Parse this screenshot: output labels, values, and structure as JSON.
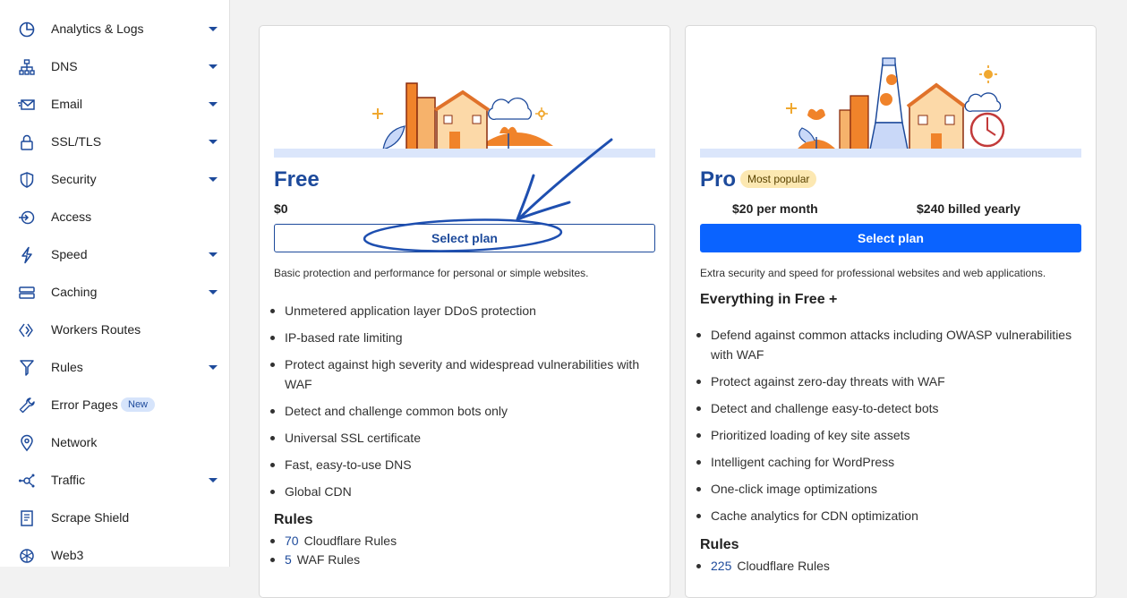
{
  "sidebar": {
    "items": [
      {
        "label": "Analytics & Logs",
        "icon": "analytics-icon",
        "caret": true
      },
      {
        "label": "DNS",
        "icon": "dns-icon",
        "caret": true
      },
      {
        "label": "Email",
        "icon": "email-icon",
        "caret": true
      },
      {
        "label": "SSL/TLS",
        "icon": "lock-icon",
        "caret": true
      },
      {
        "label": "Security",
        "icon": "shield-icon",
        "caret": true
      },
      {
        "label": "Access",
        "icon": "access-icon",
        "caret": false
      },
      {
        "label": "Speed",
        "icon": "lightning-icon",
        "caret": true
      },
      {
        "label": "Caching",
        "icon": "caching-icon",
        "caret": true
      },
      {
        "label": "Workers Routes",
        "icon": "workers-icon",
        "caret": false
      },
      {
        "label": "Rules",
        "icon": "rules-icon",
        "caret": true
      },
      {
        "label": "Error Pages",
        "icon": "wrench-icon",
        "caret": false,
        "badge": "New"
      },
      {
        "label": "Network",
        "icon": "location-pin-icon",
        "caret": false
      },
      {
        "label": "Traffic",
        "icon": "traffic-icon",
        "caret": true
      },
      {
        "label": "Scrape Shield",
        "icon": "document-icon",
        "caret": false
      },
      {
        "label": "Web3",
        "icon": "web3-icon",
        "caret": false
      }
    ]
  },
  "plans": {
    "free": {
      "title": "Free",
      "price": "$0",
      "button_label": "Select plan",
      "description": "Basic protection and performance for personal or simple websites.",
      "features": [
        "Unmetered application layer DDoS protection",
        "IP-based rate limiting",
        "Protect against high severity and widespread vulnerabilities with WAF",
        "Detect and challenge common bots only",
        "Universal SSL certificate",
        "Fast, easy-to-use DNS",
        "Global CDN"
      ],
      "rules_heading": "Rules",
      "rules": [
        {
          "count": "70",
          "label": "Cloudflare Rules"
        },
        {
          "count": "5",
          "label": "WAF Rules"
        }
      ]
    },
    "pro": {
      "title": "Pro",
      "badge": "Most popular",
      "price_monthly": "$20 per month",
      "price_yearly": "$240 billed yearly",
      "button_label": "Select plan",
      "description": "Extra security and speed for professional websites and web applications.",
      "includes_heading": "Everything in Free +",
      "features": [
        "Defend against common attacks including OWASP vulnerabilities with WAF",
        "Protect against zero-day threats with WAF",
        "Detect and challenge easy-to-detect bots",
        "Prioritized loading of key site assets",
        "Intelligent caching for WordPress",
        "One-click image optimizations",
        "Cache analytics for CDN optimization"
      ],
      "rules_heading": "Rules",
      "rules": [
        {
          "count": "225",
          "label": "Cloudflare Rules"
        }
      ]
    }
  },
  "colors": {
    "accent": "#1d4a9b",
    "primary_button": "#0a63ff",
    "annotation": "#1e4fb0",
    "badge_popular": "#fce8b2"
  }
}
